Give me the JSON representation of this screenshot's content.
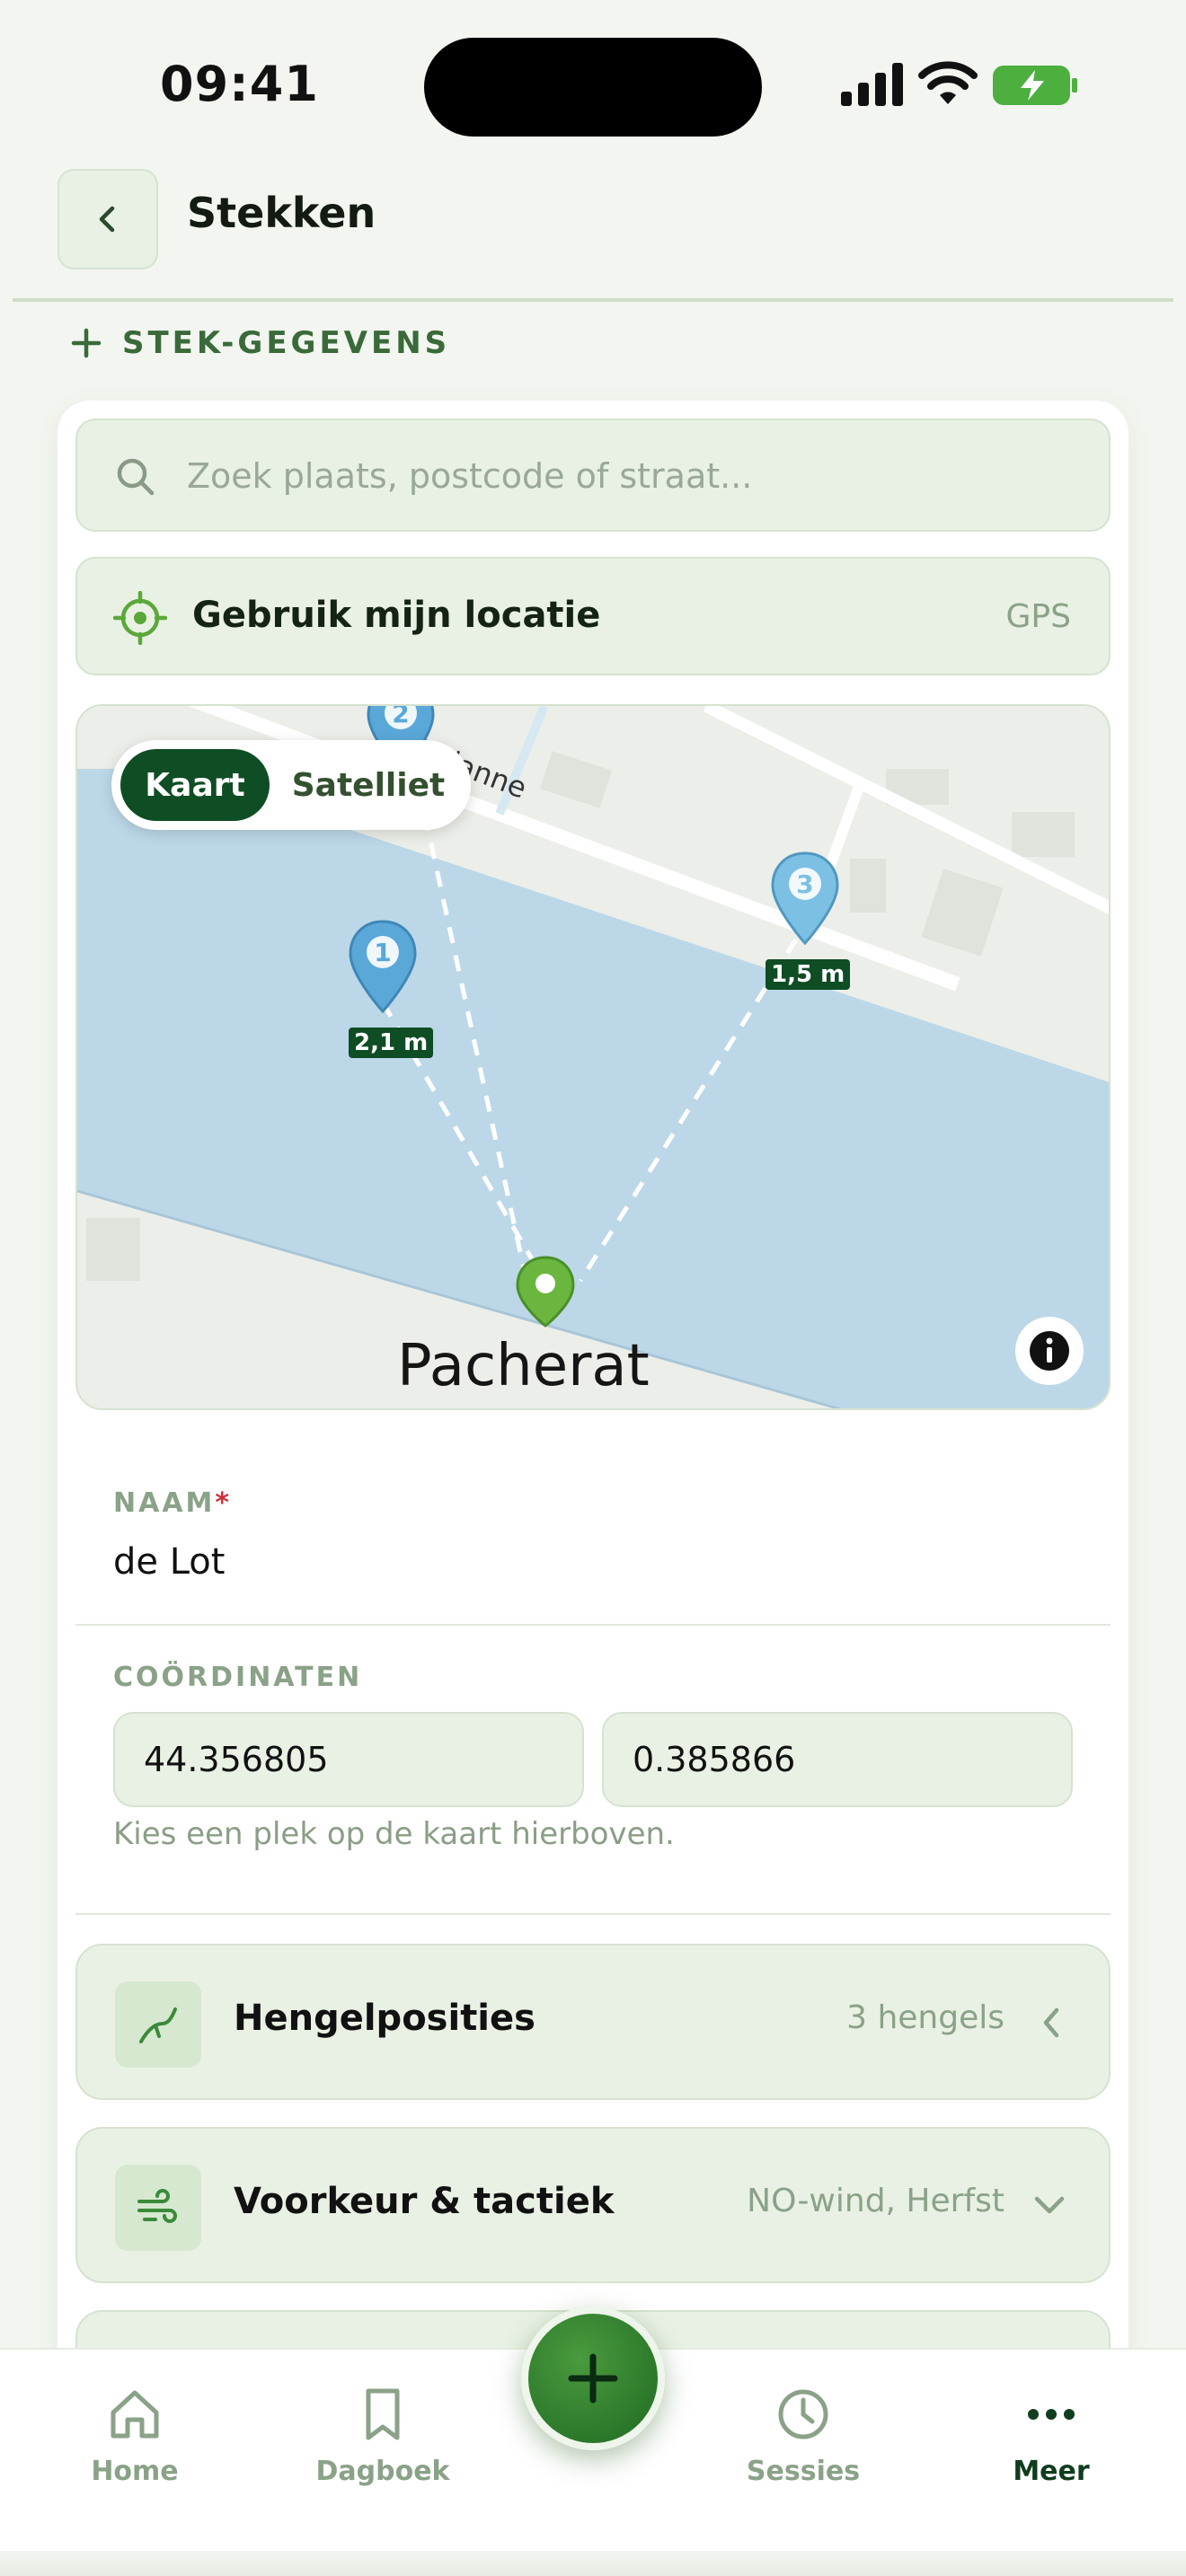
{
  "status": {
    "time": "09:41"
  },
  "header": {
    "title": "Stekken"
  },
  "section": {
    "label": "STEK-GEGEVENS"
  },
  "search": {
    "placeholder": "Zoek plaats, postcode of straat...",
    "value": ""
  },
  "location": {
    "label": "Gebruik mijn locatie",
    "badge": "GPS"
  },
  "map": {
    "toggle": {
      "active": "Kaart",
      "inactive": "Satelliet"
    },
    "place_name": "Pacherat",
    "street": "de Lalanne",
    "pins": [
      {
        "number": "1",
        "distance": "2,1 m"
      },
      {
        "number": "2",
        "distance": ""
      },
      {
        "number": "3",
        "distance": "1,5 m"
      }
    ]
  },
  "form": {
    "name_label": "NAAM",
    "name_required": "*",
    "name_value": "de Lot",
    "coords_label": "COÖRDINATEN",
    "lat": "44.356805",
    "lon": "0.385866",
    "coords_hint": "Kies een plek op de kaart hierboven."
  },
  "accordions": [
    {
      "title": "Hengelposities",
      "meta": "3 hengels",
      "icon": "rod-icon"
    },
    {
      "title": "Voorkeur & tactiek",
      "meta": "NO-wind, Herfst",
      "icon": "wind-icon"
    }
  ],
  "nav": [
    {
      "label": "Home",
      "icon": "home-icon"
    },
    {
      "label": "Dagboek",
      "icon": "bookmark-icon"
    },
    {
      "label": "Sessies",
      "icon": "clock-icon"
    },
    {
      "label": "Meer",
      "icon": "more-icon"
    }
  ],
  "colors": {
    "primary": "#0f4d24",
    "accent": "#5aa83a",
    "surface": "#e9f1e4",
    "water": "#bcd8e8"
  }
}
